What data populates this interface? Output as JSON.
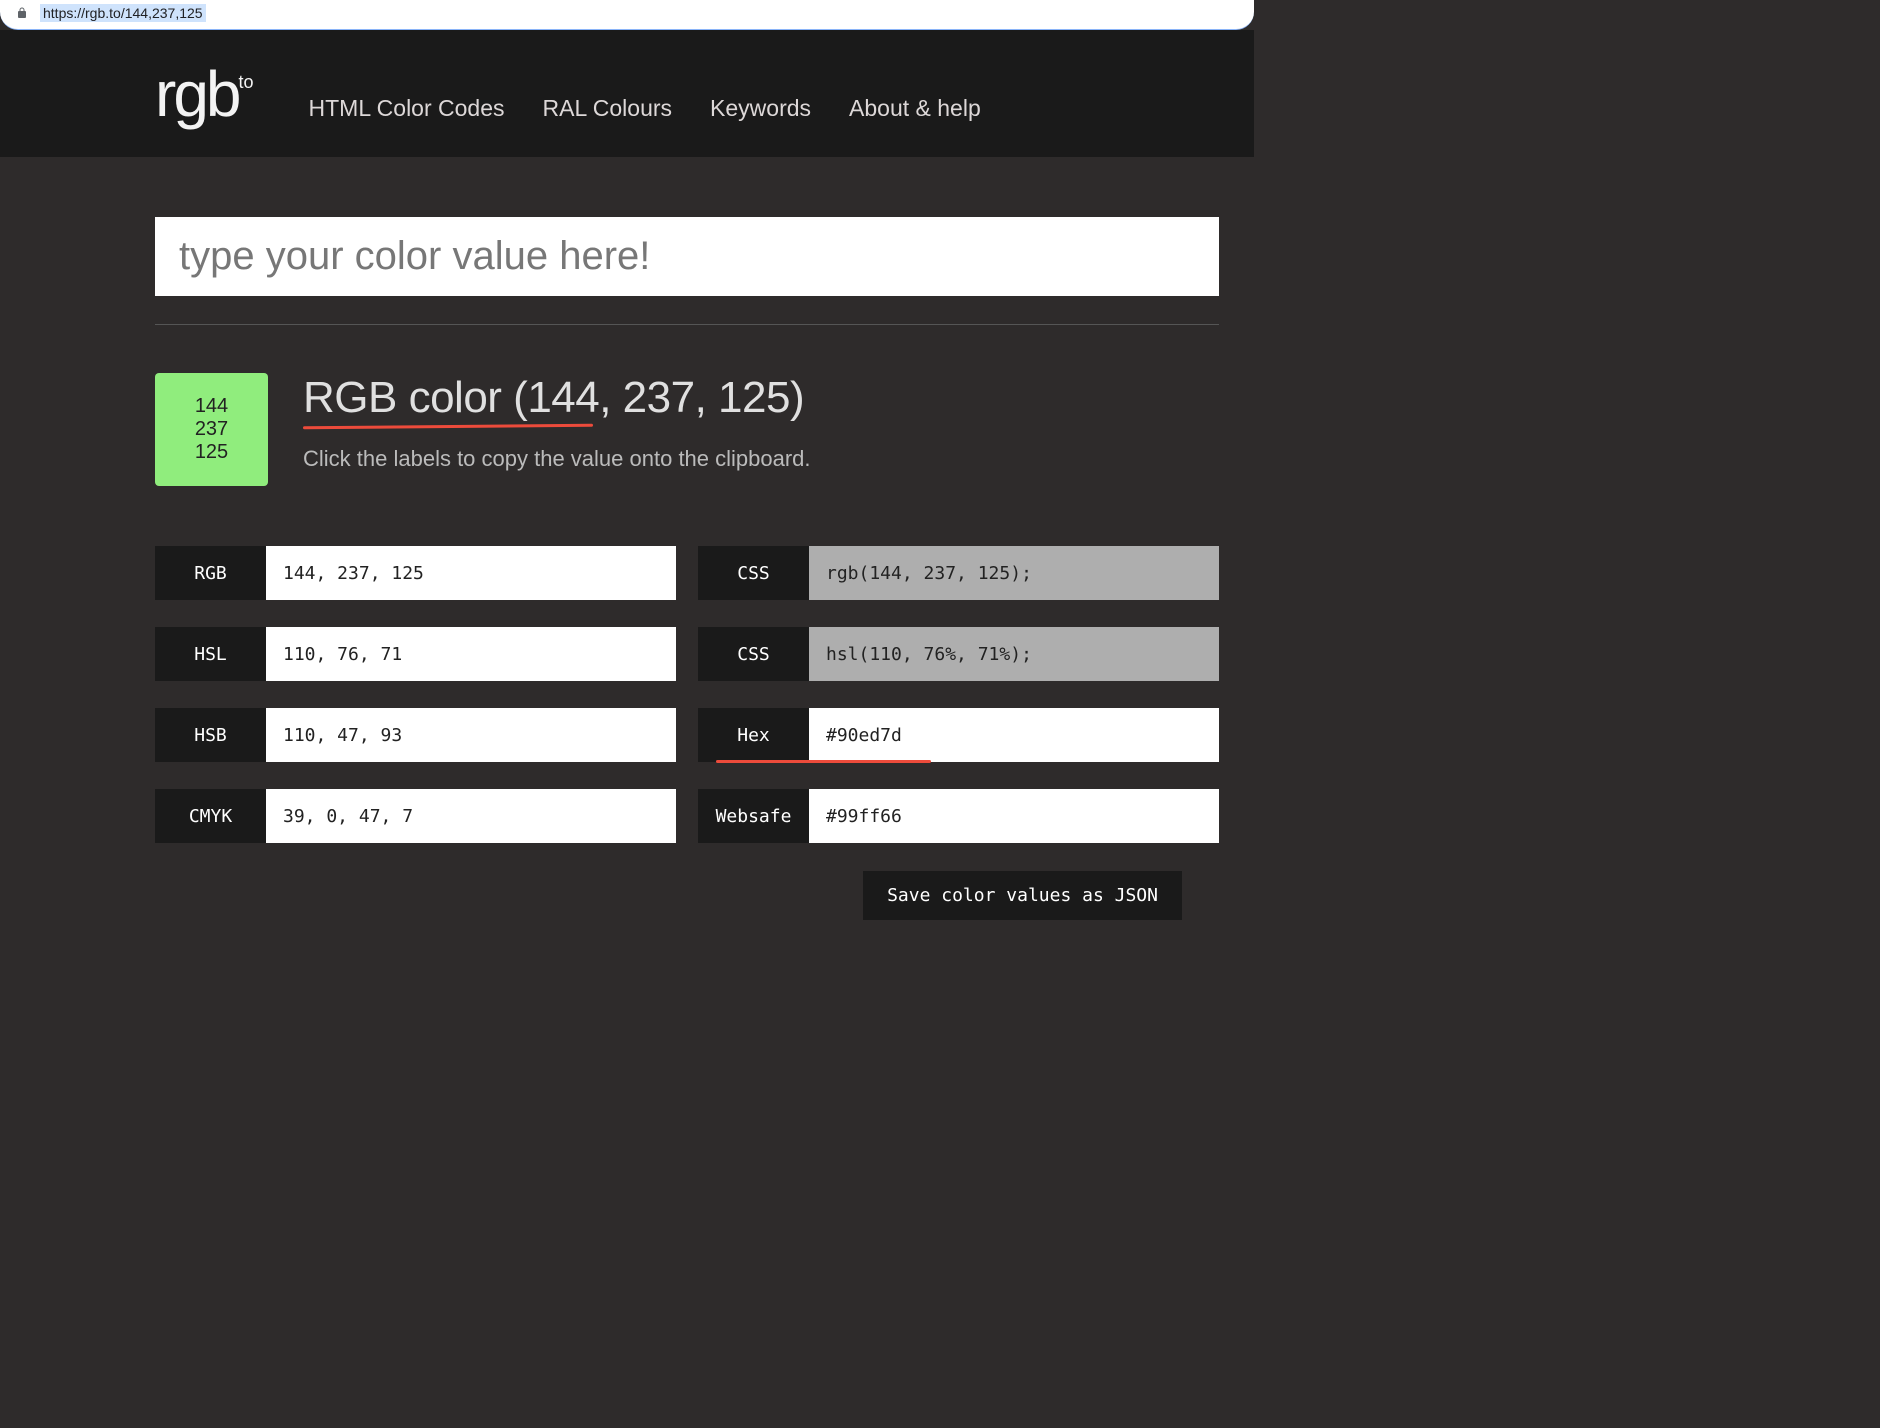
{
  "url": "https://rgb.to/144,237,125",
  "logo": {
    "main": "rgb",
    "sup": "to"
  },
  "nav": [
    "HTML Color Codes",
    "RAL Colours",
    "Keywords",
    "About & help"
  ],
  "search": {
    "placeholder": "type your color value here!"
  },
  "swatch": {
    "bg": "#90ed7d",
    "r": "144",
    "g": "237",
    "b": "125"
  },
  "title": "RGB color (144, 237, 125)",
  "subtitle": "Click the labels to copy the value onto the clipboard.",
  "values": {
    "rgb": {
      "label": "RGB",
      "value": "144, 237, 125",
      "bg": "white"
    },
    "css1": {
      "label": "CSS",
      "value": "rgb(144, 237, 125);",
      "bg": "grey"
    },
    "hsl": {
      "label": "HSL",
      "value": "110, 76, 71",
      "bg": "white"
    },
    "css2": {
      "label": "CSS",
      "value": "hsl(110, 76%, 71%);",
      "bg": "grey"
    },
    "hsb": {
      "label": "HSB",
      "value": "110, 47, 93",
      "bg": "white"
    },
    "hex": {
      "label": "Hex",
      "value": "#90ed7d",
      "bg": "white"
    },
    "cmyk": {
      "label": "CMYK",
      "value": "39, 0, 47, 7",
      "bg": "white"
    },
    "websafe": {
      "label": "Websafe",
      "value": "#99ff66",
      "bg": "white"
    }
  },
  "save_label": "Save color values as JSON"
}
